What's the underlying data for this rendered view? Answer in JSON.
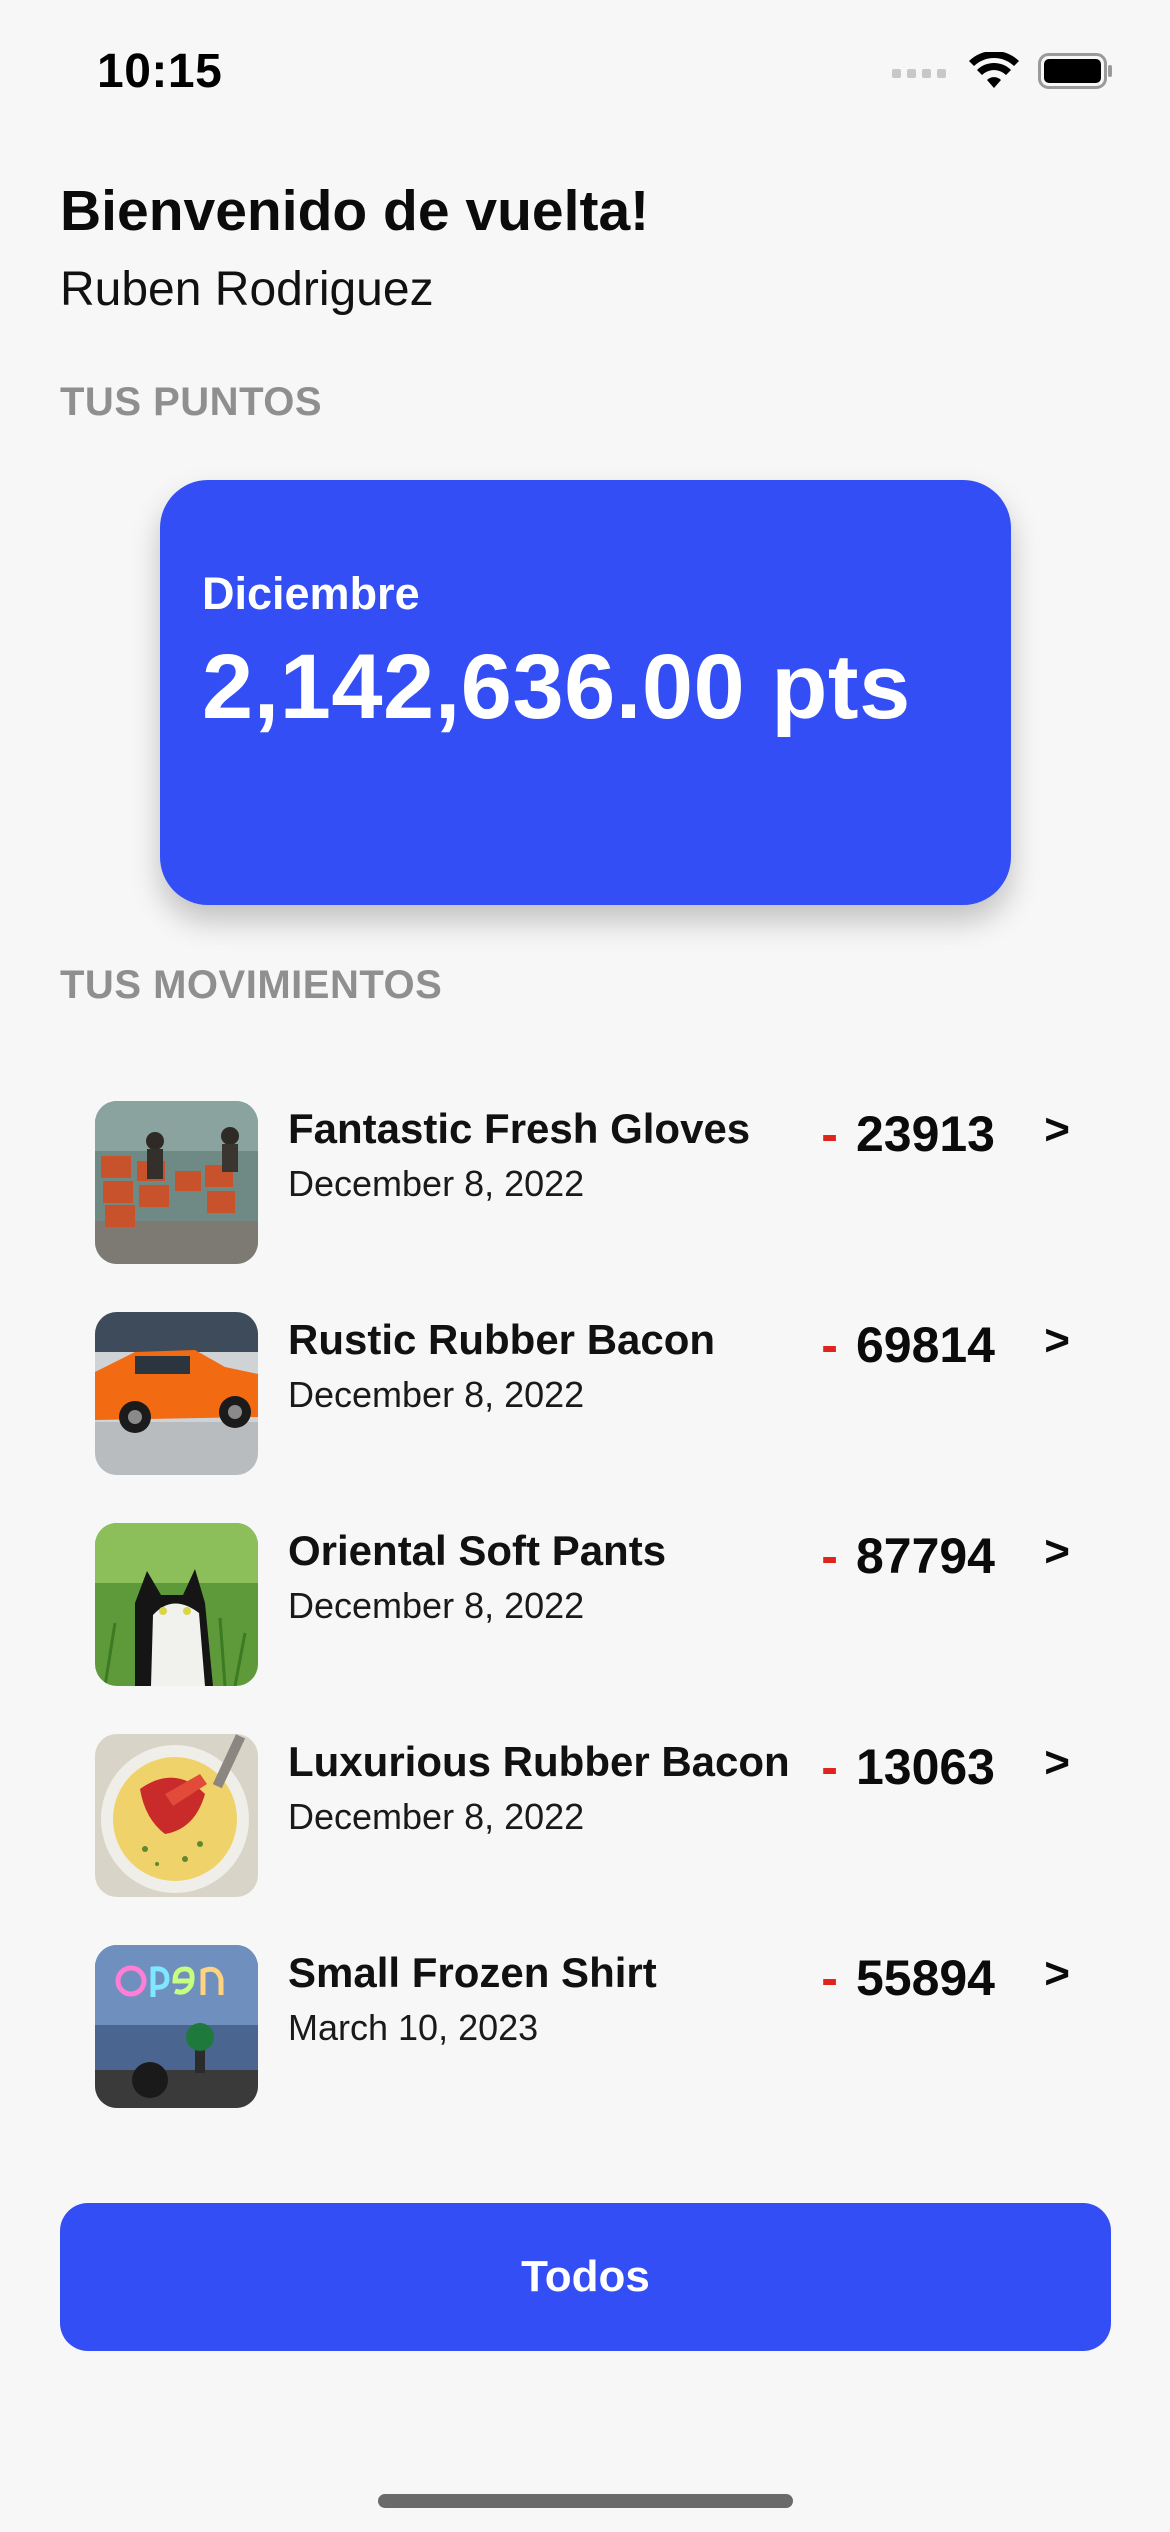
{
  "status_bar": {
    "time": "10:15",
    "icons": [
      "cellular-signal-icon",
      "wifi-icon",
      "battery-icon"
    ]
  },
  "header": {
    "greeting": "Bienvenido de vuelta!",
    "user_name": "Ruben Rodriguez"
  },
  "points_section": {
    "label": "TUS PUNTOS",
    "card": {
      "month": "Diciembre",
      "value": "2,142,636.00 pts"
    }
  },
  "movements_section": {
    "label": "TUS MOVIMIENTOS",
    "items": [
      {
        "title": "Fantastic Fresh Gloves",
        "date": "December 8, 2022",
        "sign": "-",
        "amount": "23913",
        "chevron": ">",
        "image": "market-crates-photo"
      },
      {
        "title": "Rustic Rubber Bacon",
        "date": "December 8, 2022",
        "sign": "-",
        "amount": "69814",
        "chevron": ">",
        "image": "orange-car-photo"
      },
      {
        "title": "Oriental Soft Pants",
        "date": "December 8, 2022",
        "sign": "-",
        "amount": "87794",
        "chevron": ">",
        "image": "cat-in-grass-photo"
      },
      {
        "title": "Luxurious Rubber Bacon",
        "date": "December 8, 2022",
        "sign": "-",
        "amount": "13063",
        "chevron": ">",
        "image": "lobster-dish-photo"
      },
      {
        "title": "Small Frozen Shirt",
        "date": "March 10, 2023",
        "sign": "-",
        "amount": "55894",
        "chevron": ">",
        "image": "neon-open-sign-photo"
      }
    ]
  },
  "footer": {
    "all_button_label": "Todos"
  },
  "colors": {
    "accent": "#344ef5",
    "background": "#f7f7f7",
    "negative_sign": "#e0241b",
    "section_label": "#8f8f8f"
  }
}
